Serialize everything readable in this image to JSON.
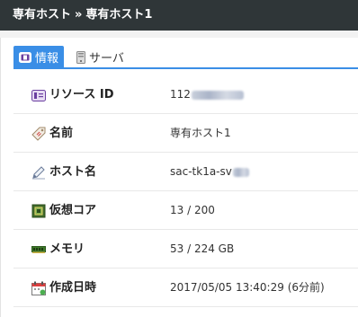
{
  "breadcrumb": {
    "parent": "専有ホスト",
    "separator": "»",
    "current": "専有ホスト1"
  },
  "tabs": [
    {
      "label": "情報",
      "icon": "info-card-icon",
      "active": true
    },
    {
      "label": "サーバ",
      "icon": "server-tower-icon",
      "active": false
    }
  ],
  "details": {
    "resource_id": {
      "label": "リソース ID",
      "value": "112",
      "icon": "id-card-icon"
    },
    "name": {
      "label": "名前",
      "value": "専有ホスト1",
      "icon": "tag-icon"
    },
    "hostname": {
      "label": "ホスト名",
      "value": "sac-tk1a-sv",
      "icon": "pen-icon"
    },
    "vcores": {
      "label": "仮想コア",
      "value": "13 / 200",
      "icon": "cpu-chip-icon"
    },
    "memory": {
      "label": "メモリ",
      "value": "53 / 224 GB",
      "icon": "memory-module-icon"
    },
    "created": {
      "label": "作成日時",
      "value": "2017/05/05 13:40:29 (6分前)",
      "icon": "calendar-icon"
    }
  },
  "colors": {
    "header_bg": "#2f3638",
    "tab_active_bg": "#3a8ee6",
    "row_divider": "#e8e8e8"
  }
}
